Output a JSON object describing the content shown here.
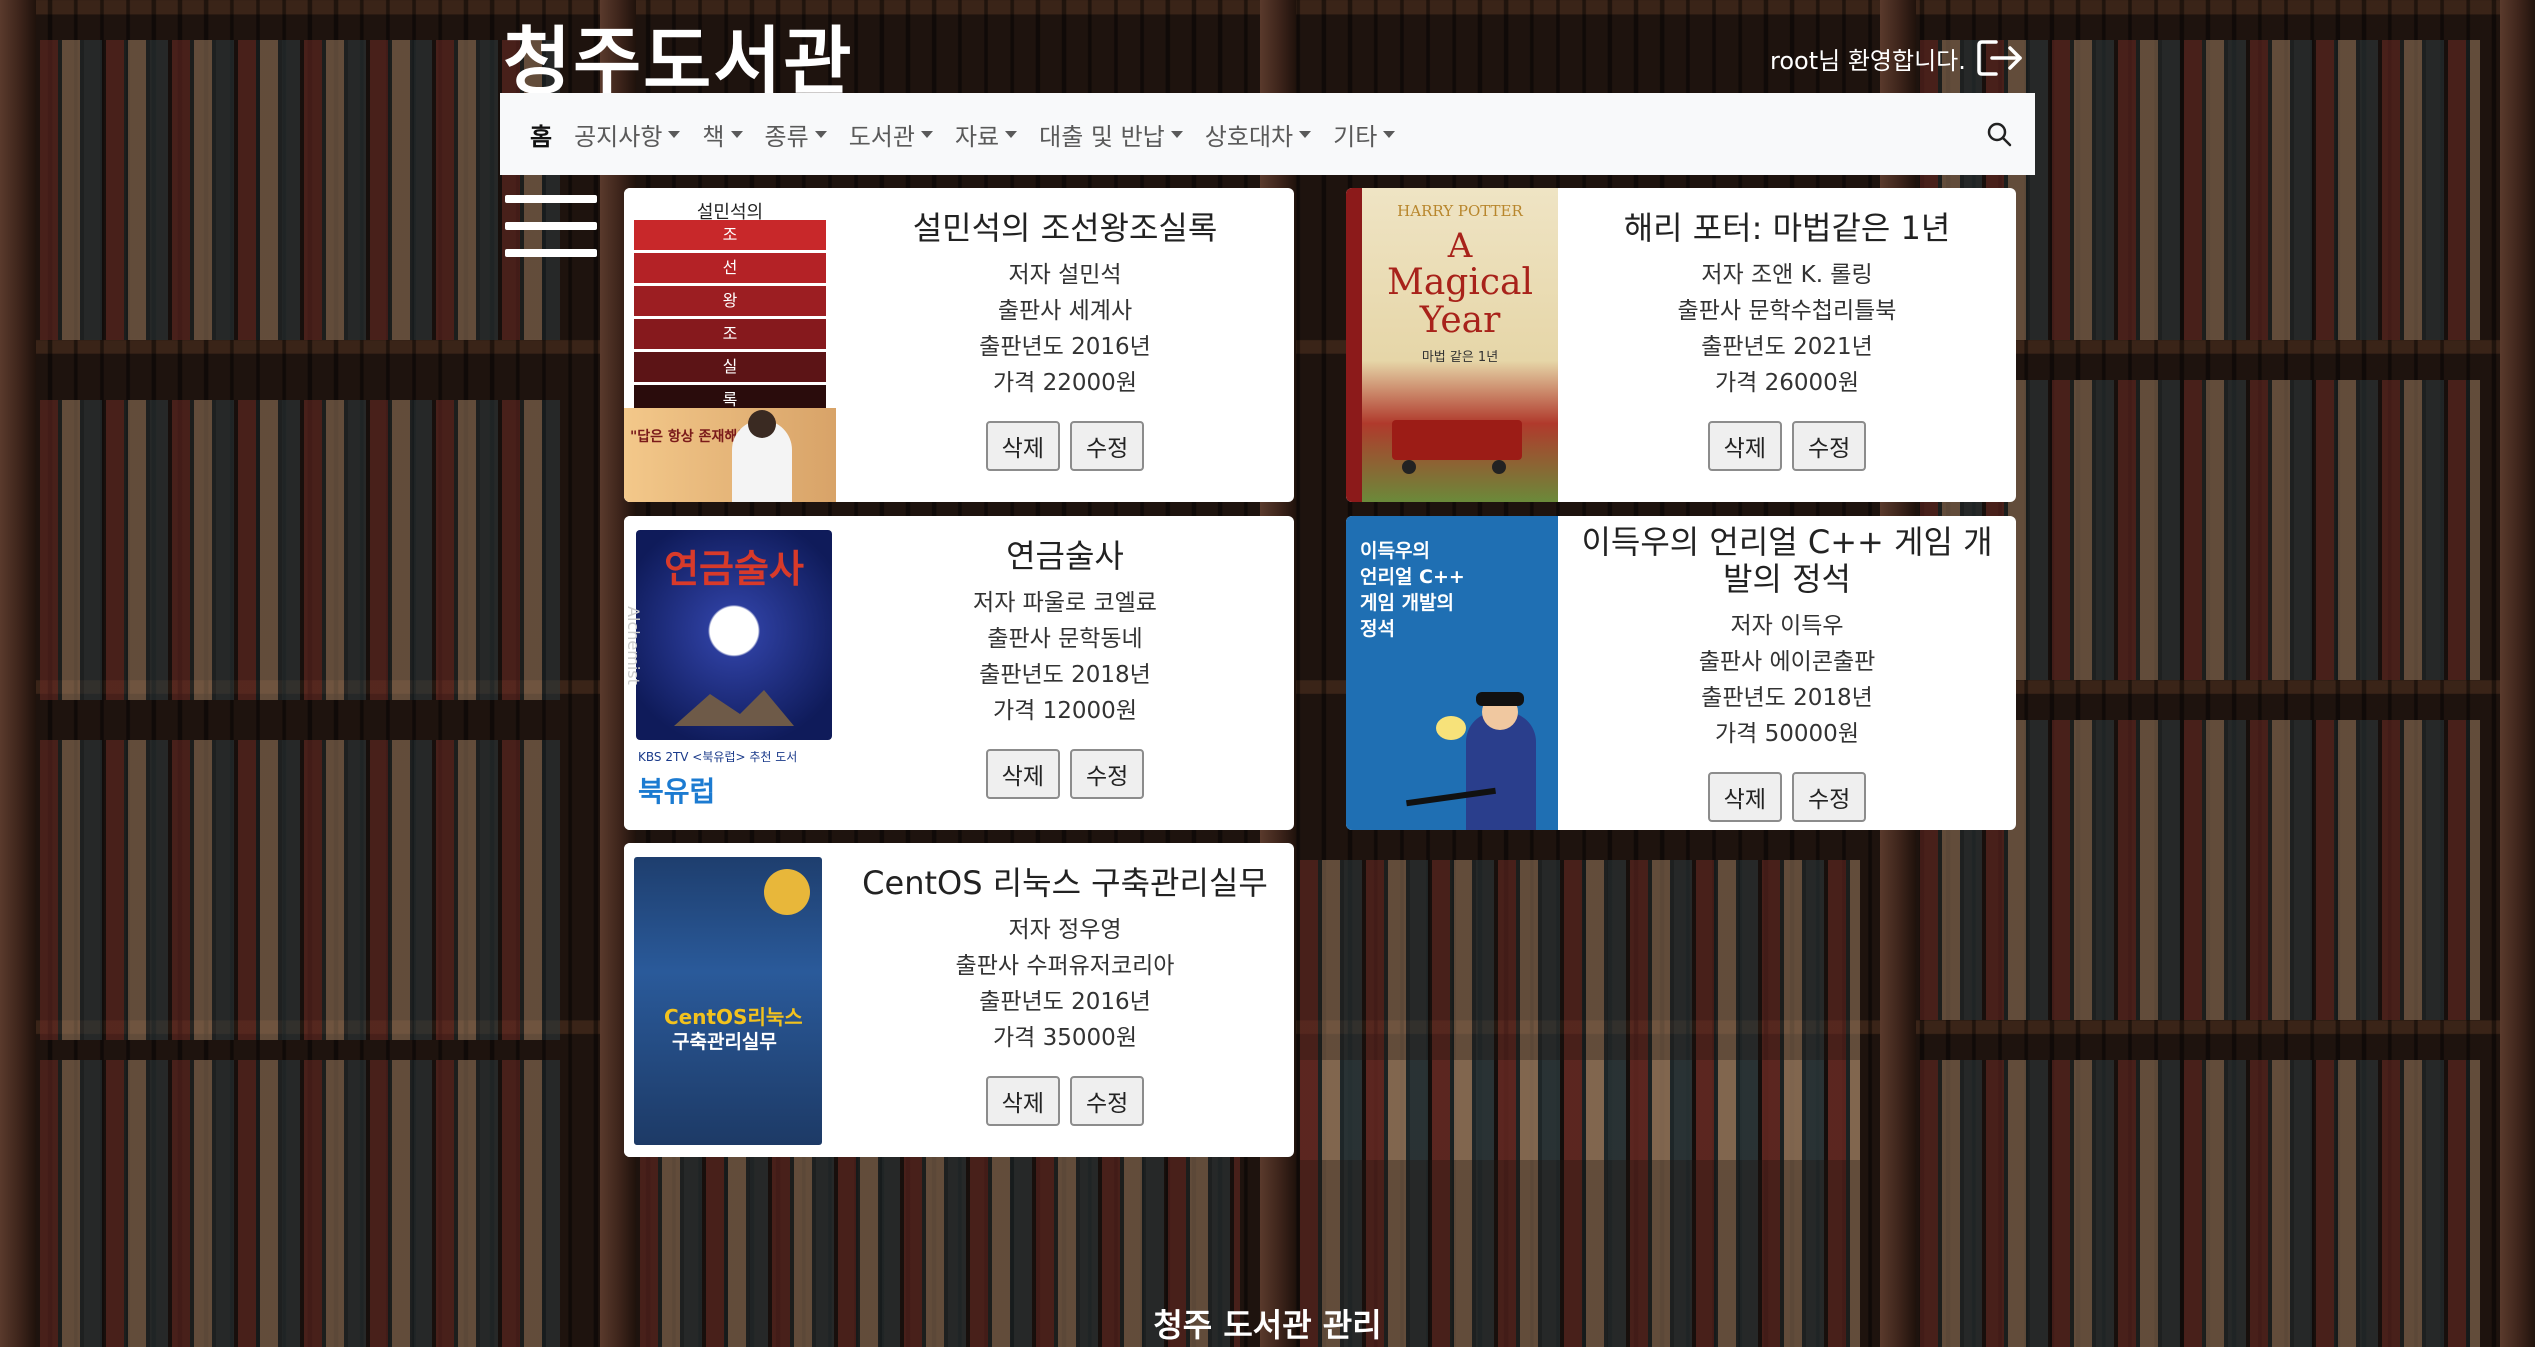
{
  "header": {
    "site_title": "청주도서관",
    "welcome_text": "root님 환영합니다.",
    "logout_icon": "logout-icon"
  },
  "navbar": {
    "items": [
      {
        "label": "홈",
        "dropdown": false
      },
      {
        "label": "공지사항",
        "dropdown": true
      },
      {
        "label": "책",
        "dropdown": true
      },
      {
        "label": "종류",
        "dropdown": true
      },
      {
        "label": "도서관",
        "dropdown": true
      },
      {
        "label": "자료",
        "dropdown": true
      },
      {
        "label": "대출 및 반납",
        "dropdown": true
      },
      {
        "label": "상호대차",
        "dropdown": true
      },
      {
        "label": "기타",
        "dropdown": true
      }
    ],
    "search_icon": "search-icon"
  },
  "books": [
    {
      "title": "설민석의 조선왕조실록",
      "author": "저자 설민석",
      "publisher": "출판사 세계사",
      "year": "출판년도 2016년",
      "price": "가격 22000원",
      "delete_label": "삭제",
      "edit_label": "수정",
      "cover": {
        "top": "설민석의",
        "chars": [
          "조",
          "선",
          "왕",
          "조",
          "실",
          "록"
        ],
        "note": "\"답은 항상 존재해왔다!\""
      }
    },
    {
      "title": "해리 포터: 마법같은 1년",
      "author": "저자 조앤 K. 롤링",
      "publisher": "출판사 문학수첩리틀북",
      "year": "출판년도 2021년",
      "price": "가격 26000원",
      "delete_label": "삭제",
      "edit_label": "수정",
      "cover": {
        "series": "HARRY POTTER",
        "line1": "A",
        "line2": "Magical",
        "line3": "Year",
        "sub": "마법 같은 1년"
      }
    },
    {
      "title": "연금술사",
      "author": "저자 파울로 코엘료",
      "publisher": "출판사 문학동네",
      "year": "출판년도 2018년",
      "price": "가격 12000원",
      "delete_label": "삭제",
      "edit_label": "수정",
      "cover": {
        "title": "연금술사",
        "side": "Alchemist",
        "badge": "KBS 2TV <북유럽> 추천 도서",
        "logo": "북유럽"
      }
    },
    {
      "title": "이득우의 언리얼 C++ 게임 개발의 정석",
      "author": "저자 이득우",
      "publisher": "출판사 에이콘출판",
      "year": "출판년도 2018년",
      "price": "가격 50000원",
      "delete_label": "삭제",
      "edit_label": "수정",
      "cover": {
        "line1": "이득우의",
        "line2": "언리얼 C++",
        "line3": "게임 개발의",
        "line4": "정석"
      }
    },
    {
      "title": "CentOS 리눅스 구축관리실무",
      "author": "저자 정우영",
      "publisher": "출판사 수퍼유저코리아",
      "year": "출판년도 2016년",
      "price": "가격 35000원",
      "delete_label": "삭제",
      "edit_label": "수정",
      "cover": {
        "line1": "CentOS리눅스",
        "line2": "구축관리실무"
      }
    }
  ],
  "footer": {
    "text": "청주 도서관 관리"
  },
  "colors": {
    "navbar_bg": "#f8f9fa",
    "card_bg": "#ffffff",
    "text_white": "#ffffff"
  }
}
